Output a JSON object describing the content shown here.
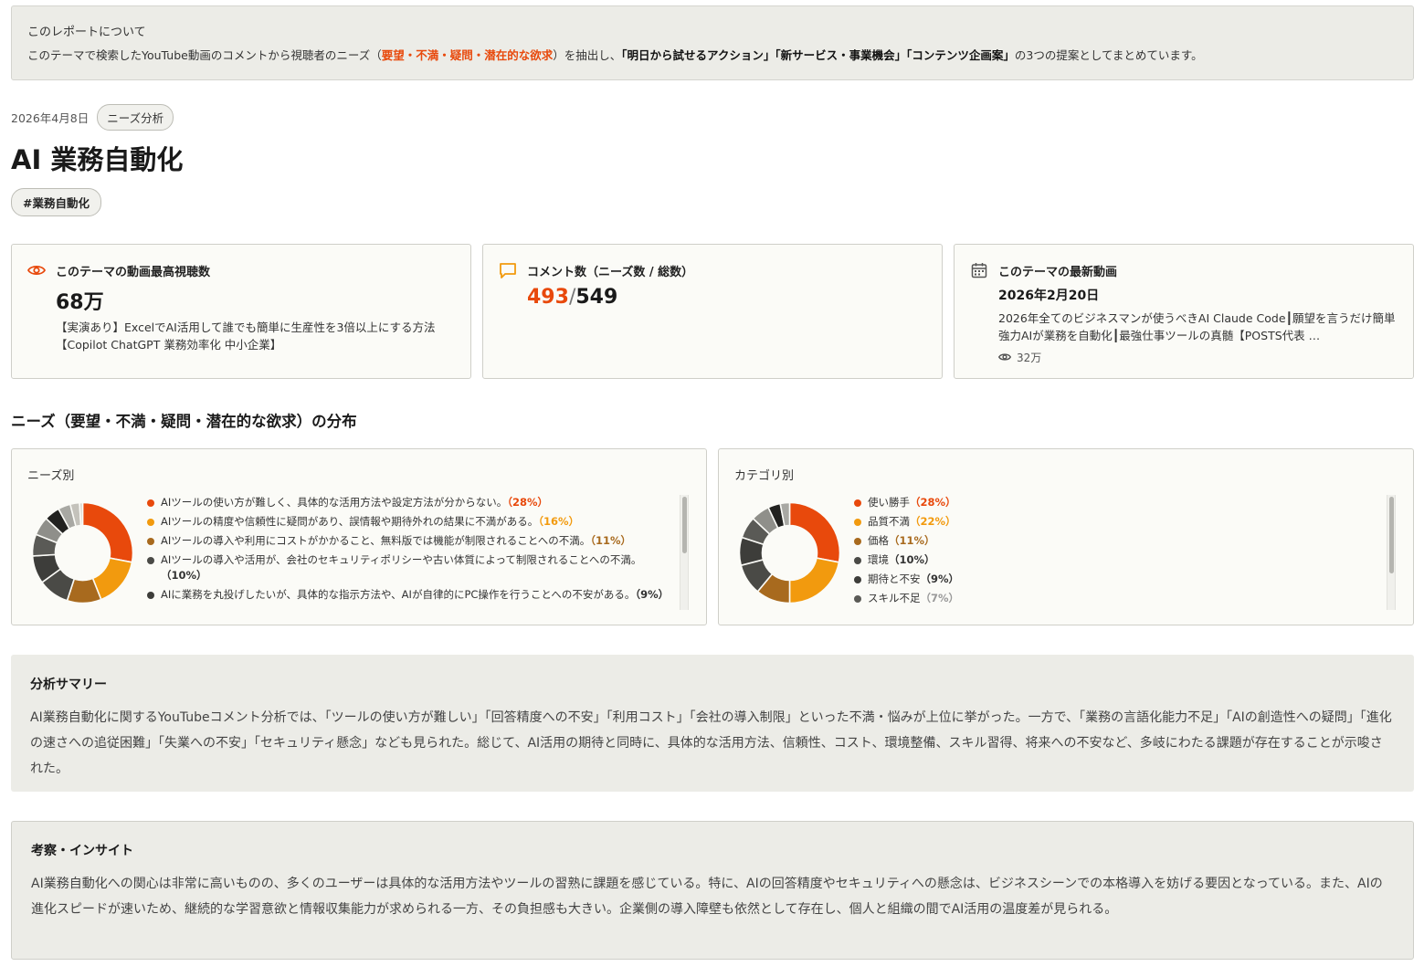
{
  "about": {
    "title": "このレポートについて",
    "desc_pre": "このテーマで検索したYouTube動画のコメントから視聴者のニーズ（",
    "desc_highlight": "要望・不満・疑問・潜在的な欲求",
    "desc_mid": "）を抽出し、",
    "desc_actions": "「明日から試せるアクション」「新サービス・事業機会」「コンテンツ企画案」",
    "desc_post": "の3つの提案としてまとめています。"
  },
  "report": {
    "date": "2026年4月8日",
    "type_badge": "ニーズ分析",
    "title": "AI 業務自動化",
    "hashtag": "#業務自動化"
  },
  "stats": {
    "views": {
      "label": "このテーマの動画最高視聴数",
      "value": "68万",
      "video_title": "【実演あり】ExcelでAI活用して誰でも簡単に生産性を3倍以上にする方法【Copilot ChatGPT 業務効率化 中小企業】"
    },
    "comments": {
      "label": "コメント数（ニーズ数 / 総数）",
      "needs": "493",
      "sep": "/",
      "total": "549"
    },
    "latest": {
      "label": "このテーマの最新動画",
      "date": "2026年2月20日",
      "video_title": "2026年全てのビジネスマンが使うべきAI Claude Code┃願望を言うだけ簡単強力AIが業務を自動化┃最強仕事ツールの真髄【POSTS代表 …",
      "views": "32万"
    }
  },
  "distribution": {
    "section_title": "ニーズ（要望・不満・疑問・潜在的な欲求）の分布",
    "needs_chart_title": "ニーズ別",
    "category_chart_title": "カテゴリ別"
  },
  "colors": {
    "accent": "#e8490c",
    "palette": [
      "#e8490c",
      "#f29a0e",
      "#a86a1e",
      "#4a4a46",
      "#3d3d3a",
      "#5a5a56",
      "#8f8f8a",
      "#222220",
      "#a8a8a3",
      "#c4c2bb",
      "#d9d6cd",
      "#ecece8"
    ]
  },
  "chart_data": [
    {
      "type": "pie",
      "title": "ニーズ別",
      "categories": [
        "AIツールの使い方が難しく、具体的な活用方法や設定方法が分からない。",
        "AIツールの精度や信頼性に疑問があり、誤情報や期待外れの結果に不満がある。",
        "AIツールの導入や利用にコストがかかること、無料版では機能が制限されることへの不満。",
        "AIツールの導入や活用が、会社のセキュリティポリシーや古い体質によって制限されることへの不満。",
        "AIに業務を丸投げしたいが、具体的な指示方法や、AIが自律的にPC操作を行うことへの不安がある。",
        "",
        "",
        "",
        "",
        "",
        ""
      ],
      "values": [
        28,
        16,
        11,
        10,
        9,
        7,
        6,
        5,
        4,
        3,
        1
      ],
      "labels": [
        "（28%）",
        "（16%）",
        "（11%）",
        "（10%）",
        "（9%）"
      ]
    },
    {
      "type": "pie",
      "title": "カテゴリ別",
      "categories": [
        "使い勝手",
        "品質不満",
        "価格",
        "環境",
        "期待と不安",
        "スキル不足",
        "",
        "",
        "",
        ""
      ],
      "values": [
        28,
        22,
        11,
        10,
        9,
        7,
        6,
        4,
        3,
        0
      ],
      "labels": [
        "（28%）",
        "（22%）",
        "（11%）",
        "（10%）",
        "（9%）",
        "（7%）"
      ]
    }
  ],
  "summary": {
    "title": "分析サマリー",
    "text": "AI業務自動化に関するYouTubeコメント分析では、「ツールの使い方が難しい」「回答精度への不安」「利用コスト」「会社の導入制限」といった不満・悩みが上位に挙がった。一方で、「業務の言語化能力不足」「AIの創造性への疑問」「進化の速さへの追従困難」「失業への不安」「セキュリティ懸念」なども見られた。総じて、AI活用の期待と同時に、具体的な活用方法、信頼性、コスト、環境整備、スキル習得、将来への不安など、多岐にわたる課題が存在することが示唆された。"
  },
  "insight": {
    "title": "考察・インサイト",
    "text": "AI業務自動化への関心は非常に高いものの、多くのユーザーは具体的な活用方法やツールの習熟に課題を感じている。特に、AIの回答精度やセキュリティへの懸念は、ビジネスシーンでの本格導入を妨げる要因となっている。また、AIの進化スピードが速いため、継続的な学習意欲と情報収集能力が求められる一方、その負担感も大きい。企業側の導入障壁も依然として存在し、個人と組織の間でAI活用の温度差が見られる。"
  }
}
